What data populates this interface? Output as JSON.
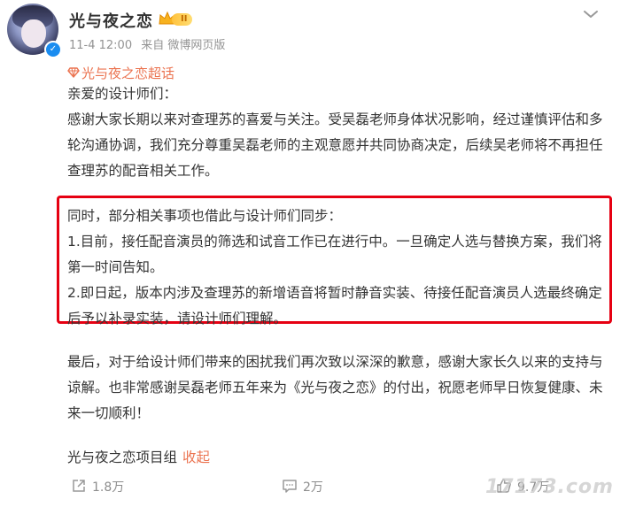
{
  "post": {
    "author": "光与夜之恋",
    "level_badge": "II",
    "timestamp": "11-4 12:00",
    "source": "来自 微博网页版",
    "topic": "光与夜之恋超话",
    "greeting": "亲爱的设计师们：",
    "body": "感谢大家长期以来对查理苏的喜爱与关注。受吴磊老师身体状况影响，经过谨慎评估和多轮沟通协调，我们充分尊重吴磊老师的主观意愿并共同协商决定，后续吴老师将不再担任查理苏的配音相关工作。",
    "highlight_lines": [
      "同时，部分相关事项也借此与设计师们同步：",
      "1.目前，接任配音演员的筛选和试音工作已在进行中。一旦确定人选与替换方案，我们将第一时间告知。",
      "2.即日起，版本内涉及查理苏的新增语音将暂时静音实装、待接任配音演员人选最终确定后予以补录实装，请设计师们理解。"
    ],
    "closing": "最后，对于给设计师们带来的困扰我们再次致以深深的歉意，感谢大家长久以来的支持与谅解。也非常感谢吴磊老师五年来为《光与夜之恋》的付出，祝愿老师早日恢复健康、未来一切顺利！",
    "signature": "光与夜之恋项目组",
    "collapse_label": "收起"
  },
  "actions": {
    "repost_count": "1.8万",
    "comment_count": "2万",
    "like_count": "9.7万"
  },
  "watermark": "17173.com",
  "colors": {
    "link_orange": "#eb7350",
    "highlight_border": "#e60012",
    "verified_blue": "#1a8cf0"
  },
  "icons": [
    "verified-icon",
    "crown-icon",
    "more-icon",
    "diamond-icon",
    "repost-icon",
    "comment-icon",
    "like-icon"
  ]
}
